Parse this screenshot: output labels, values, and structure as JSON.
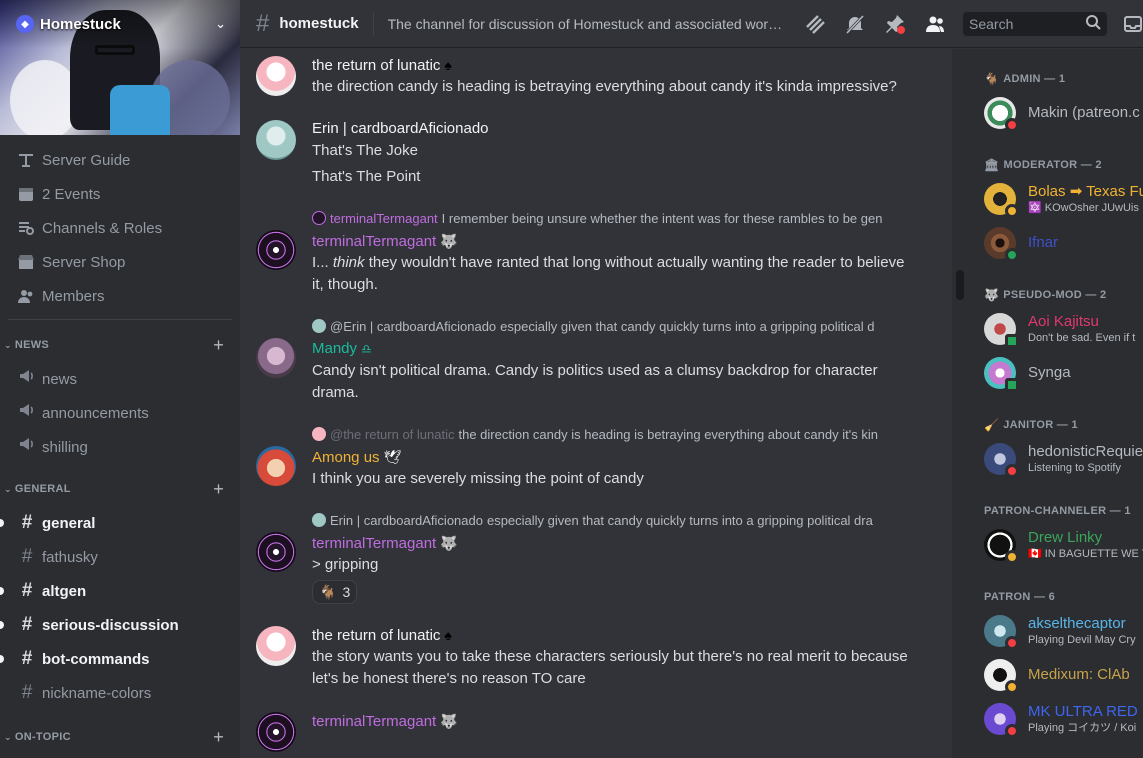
{
  "server": {
    "name": "Homestuck",
    "items": [
      {
        "label": "Server Guide",
        "icon": "guide-icon"
      },
      {
        "label": "2 Events",
        "icon": "calendar-icon"
      },
      {
        "label": "Channels & Roles",
        "icon": "browse-icon"
      },
      {
        "label": "Server Shop",
        "icon": "shop-icon"
      },
      {
        "label": "Members",
        "icon": "members-icon"
      }
    ],
    "categories": [
      {
        "name": "NEWS",
        "channels": [
          {
            "label": "news",
            "type": "announcement",
            "unread": false
          },
          {
            "label": "announcements",
            "type": "announcement",
            "unread": false
          },
          {
            "label": "shilling",
            "type": "announcement",
            "unread": false
          }
        ]
      },
      {
        "name": "GENERAL",
        "channels": [
          {
            "label": "general",
            "type": "text",
            "unread": true
          },
          {
            "label": "fathusky",
            "type": "text",
            "unread": false
          },
          {
            "label": "altgen",
            "type": "text",
            "unread": true
          },
          {
            "label": "serious-discussion",
            "type": "text",
            "unread": true
          },
          {
            "label": "bot-commands",
            "type": "text",
            "unread": true
          },
          {
            "label": "nickname-colors",
            "type": "text",
            "unread": false
          }
        ]
      },
      {
        "name": "ON-TOPIC",
        "channels": []
      }
    ]
  },
  "header": {
    "channel": "homestuck",
    "topic": "The channel for discussion of Homestuck and associated works. ...",
    "search_placeholder": "Search"
  },
  "messages": [
    {
      "user": "the return of lunatic",
      "suffix": "♠",
      "color": "#f2f3f5",
      "avatar": "#f7b5c0",
      "lines": [
        "the direction candy is heading is betraying everything about candy it's kinda impressive?"
      ]
    },
    {
      "user": "Erin | cardboardAficionado",
      "suffix": "",
      "color": "#f2f3f5",
      "avatar": "#9fc7c4",
      "lines": [
        "That's The Joke",
        "That's The Point"
      ]
    },
    {
      "reply": {
        "name": "terminalTermagant",
        "text": "I remember being unsure whether the intent was for these rambles to be gen",
        "color": "#c06de0"
      },
      "user": "terminalTermagant",
      "suffix": "🐺",
      "color": "#c06de0",
      "avatar": "#23142a",
      "lines_html_parts": [
        "I... ",
        "think",
        " they wouldn't have ranted that long without actually wanting the reader to believe it, though."
      ]
    },
    {
      "reply": {
        "name": "@Erin | cardboardAficionado",
        "text": "especially given that candy quickly turns into a gripping political d",
        "color": "#b5bac1"
      },
      "user": "Mandy",
      "suffix": "♎",
      "color": "#1abc9c",
      "avatar": "#8a6a8a",
      "lines": [
        "Candy isn't political drama.  Candy is politics used as a clumsy backdrop for character drama."
      ]
    },
    {
      "reply": {
        "name": "@the return of lunatic",
        "text": "the direction candy is heading is betraying everything about candy it's kin",
        "color": "#6d6f78"
      },
      "user": "Among us",
      "suffix": "🕊",
      "color": "#f0b232",
      "avatar": "#d84a3a",
      "lines": [
        "I think you are severely missing the point of candy"
      ]
    },
    {
      "reply": {
        "name": "Erin | cardboardAficionado",
        "text": "especially given that candy quickly turns into a gripping political dra",
        "color": "#b5bac1"
      },
      "user": "terminalTermagant",
      "suffix": "🐺",
      "color": "#c06de0",
      "avatar": "#23142a",
      "lines": [
        "> gripping"
      ],
      "reaction": {
        "emoji": "🐐",
        "count": "3"
      }
    },
    {
      "user": "the return of lunatic",
      "suffix": "♠",
      "color": "#f2f3f5",
      "avatar": "#f7b5c0",
      "lines": [
        "the story wants you to take these characters seriously but there's no real merit to because let's be honest there's no reason TO care"
      ]
    },
    {
      "user": "terminalTermagant",
      "suffix": "🐺",
      "color": "#c06de0",
      "avatar": "#23142a",
      "lines": []
    }
  ],
  "member_groups": [
    {
      "name": "ADMIN — 1",
      "icon": "🐐",
      "members": [
        {
          "name": "Makin (patreon.c",
          "color": "#b5bac1",
          "activity": "",
          "avatar": "#e8e8e8",
          "status": "dnd"
        }
      ]
    },
    {
      "name": "MODERATOR — 2",
      "icon": "🏛",
      "members": [
        {
          "name": "Bolas ➡ Texas Fu",
          "color": "#f0b232",
          "activity": "🔯 KOwOsher JUwUis",
          "avatar": "#e2b23a",
          "status": "idle"
        },
        {
          "name": "Ifnar",
          "color": "#3e50c7",
          "activity": "",
          "avatar": "#5a3a2a",
          "status": "online"
        }
      ]
    },
    {
      "name": "PSEUDO-MOD — 2",
      "icon": "🐺",
      "members": [
        {
          "name": "Aoi Kajitsu",
          "color": "#e0386e",
          "activity": "Don't be sad. Even if t",
          "avatar": "#d8d8d8",
          "status": "mobile"
        },
        {
          "name": "Synga",
          "color": "#b5bac1",
          "activity": "",
          "avatar": "#c57ad0",
          "status": "mobile"
        }
      ]
    },
    {
      "name": "JANITOR — 1",
      "icon": "🧹",
      "members": [
        {
          "name": "hedonisticRequie",
          "color": "#b5bac1",
          "activity": "Listening to Spotify",
          "avatar": "#3a4a7a",
          "status": "dnd"
        }
      ]
    },
    {
      "name": "PATRON-CHANNELER — 1",
      "icon": "",
      "members": [
        {
          "name": "Drew Linky",
          "color": "#3ba55c",
          "activity": "🇨🇦 IN BAGUETTE WE T",
          "avatar": "#111111",
          "status": "idle"
        }
      ]
    },
    {
      "name": "PATRON — 6",
      "icon": "",
      "members": [
        {
          "name": "akselthecaptor",
          "color": "#5ab5e8",
          "activity": "Playing Devil May Cry",
          "avatar": "#4a7a8a",
          "status": "dnd"
        },
        {
          "name": "Medixum: ClAb",
          "color": "#c8a24a",
          "activity": "",
          "avatar": "#eeeeee",
          "status": "idle"
        },
        {
          "name": "MK ULTRA RED",
          "color": "#3e66f0",
          "activity": "Playing コイカツ / Koi",
          "avatar": "#6a4ad0",
          "status": "dnd"
        }
      ]
    }
  ]
}
